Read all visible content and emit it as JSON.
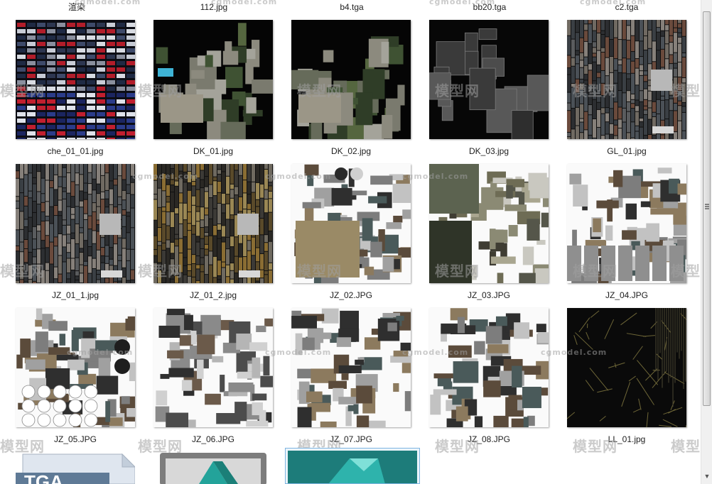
{
  "top_row_labels": [
    "渲染",
    "112.jpg",
    "b4.tga",
    "bb20.tga",
    "c2.tga"
  ],
  "files": [
    {
      "name": "che_01_01.jpg",
      "style": "cars"
    },
    {
      "name": "DK_01.jpg",
      "style": "aerial"
    },
    {
      "name": "DK_02.jpg",
      "style": "aerial2"
    },
    {
      "name": "DK_03.jpg",
      "style": "roofs"
    },
    {
      "name": "GL_01.jpg",
      "style": "facade-dark"
    },
    {
      "name": "JZ_01_1.jpg",
      "style": "facade-dark"
    },
    {
      "name": "JZ_01_2.jpg",
      "style": "facade-gold"
    },
    {
      "name": "JZ_02.JPG",
      "style": "atlas-white"
    },
    {
      "name": "JZ_03.JPG",
      "style": "atlas-rock"
    },
    {
      "name": "JZ_04.JPG",
      "style": "atlas-white2"
    },
    {
      "name": "JZ_05.JPG",
      "style": "atlas-circles"
    },
    {
      "name": "JZ_06.JPG",
      "style": "atlas-gray"
    },
    {
      "name": "JZ_07.JPG",
      "style": "atlas-white3"
    },
    {
      "name": "JZ_08.JPG",
      "style": "atlas-white4"
    },
    {
      "name": "LL_01.jpg",
      "style": "lines-dark"
    }
  ],
  "watermark": {
    "big": "模型网",
    "small": "cgmodel.com"
  },
  "bottom_icons": [
    {
      "name": "tga-file-icon",
      "text": "TGA"
    },
    {
      "name": "3dsmax-file-icon",
      "text": ""
    },
    {
      "name": "3dsmax-file-icon-selected",
      "text": ""
    }
  ],
  "colors": {
    "selection_border": "#7fb5e0",
    "selection_fill": "#eaf4fc"
  }
}
